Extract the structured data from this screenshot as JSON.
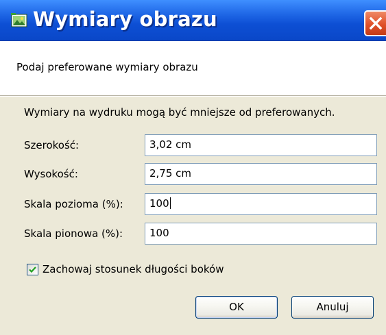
{
  "window": {
    "title": "Wymiary obrazu",
    "accent_color": "#0a47c8",
    "icons": {
      "app": "image-icon",
      "close": "close-icon"
    }
  },
  "header": {
    "subtitle": "Podaj preferowane wymiary obrazu"
  },
  "form": {
    "info": "Wymiary na wydruku mogą być mniejsze od preferowanych.",
    "fields": [
      {
        "label": "Szerokość:",
        "value": "3,02 cm"
      },
      {
        "label": "Wysokość:",
        "value": "2,75 cm"
      },
      {
        "label": "Skala pozioma (%):",
        "value": "100",
        "focused": true
      },
      {
        "label": "Skala pionowa (%):",
        "value": "100"
      }
    ],
    "keep_ratio": {
      "label": "Zachowaj stosunek długości boków",
      "checked": true
    }
  },
  "buttons": {
    "ok": "OK",
    "cancel": "Anuluj"
  }
}
